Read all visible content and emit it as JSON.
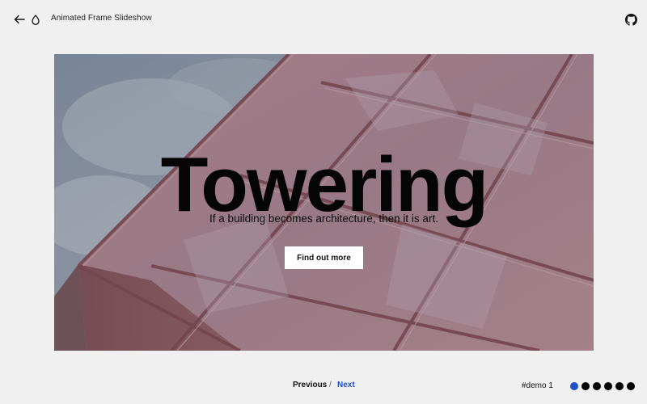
{
  "header": {
    "title": "Animated Frame Slideshow"
  },
  "icons": {
    "back": "arrow-left-icon",
    "theme": "droplet-icon",
    "repo": "github-icon"
  },
  "slide": {
    "title": "Towering",
    "subtitle": "If a building becomes architecture, then it is art.",
    "cta_label": "Find out more"
  },
  "navigation": {
    "previous_label": "Previous",
    "separator": "/",
    "next_label": "Next"
  },
  "demo": {
    "label": "#demo 1",
    "dots": [
      {
        "active": true
      },
      {
        "active": false
      },
      {
        "active": false
      },
      {
        "active": false
      },
      {
        "active": false
      },
      {
        "active": false
      }
    ]
  },
  "colors": {
    "accent": "#1f4fc6",
    "background": "#f0f0f0",
    "button_bg": "#ffffff",
    "text": "#111111"
  }
}
